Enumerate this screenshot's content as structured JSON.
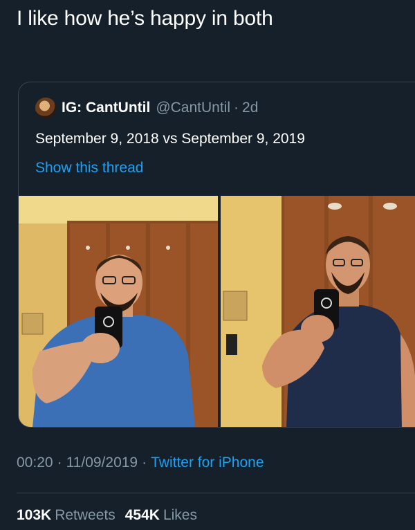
{
  "tweet": {
    "text": "I like how he’s happy in both"
  },
  "quoted_tweet": {
    "display_name": "IG: CantUntil",
    "handle": "@CantUntil",
    "separator": "·",
    "age": "2d",
    "text": "September 9, 2018 vs September 9, 2019",
    "thread_link": "Show this thread",
    "avatar_icon": "profile-photo-icon",
    "photos": [
      {
        "label": "before-photo",
        "shirt_color": "#3b6fb6"
      },
      {
        "label": "after-photo",
        "shirt_color": "#1f2c4a"
      }
    ]
  },
  "meta": {
    "time": "00:20",
    "separator": "·",
    "date": "11/09/2019",
    "source": "Twitter for iPhone"
  },
  "stats": {
    "retweets_count": "103K",
    "retweets_label": "Retweets",
    "likes_count": "454K",
    "likes_label": "Likes"
  },
  "colors": {
    "background": "#15202b",
    "secondary_text": "#8899a6",
    "link": "#1da1f2",
    "border": "#38444d"
  }
}
